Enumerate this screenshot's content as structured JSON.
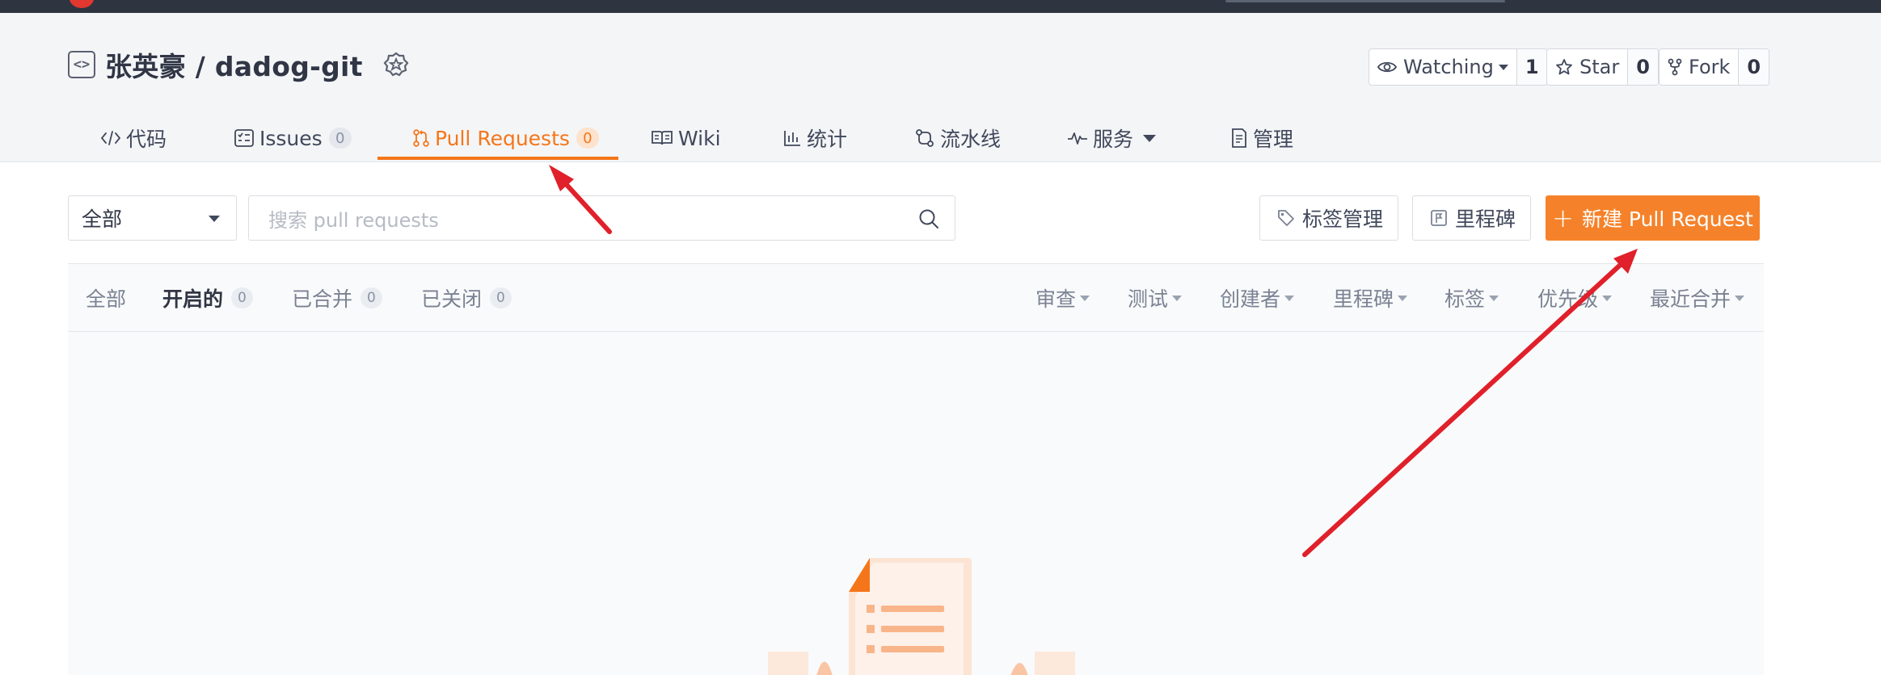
{
  "repo": {
    "owner_and_name": "张英豪 / dadog-git"
  },
  "repo_actions": {
    "watch": {
      "label": "Watching",
      "count": "1"
    },
    "star": {
      "label": "Star",
      "count": "0"
    },
    "fork": {
      "label": "Fork",
      "count": "0"
    }
  },
  "nav": {
    "tabs": [
      {
        "label": "代码",
        "icon": "code-icon"
      },
      {
        "label": "Issues",
        "count": "0",
        "icon": "issues-icon"
      },
      {
        "label": "Pull Requests",
        "count": "0",
        "icon": "pull-request-icon",
        "active": true
      },
      {
        "label": "Wiki",
        "icon": "book-icon"
      },
      {
        "label": "统计",
        "icon": "bar-chart-icon"
      },
      {
        "label": "流水线",
        "icon": "pipeline-icon"
      },
      {
        "label": "服务",
        "icon": "pulse-icon"
      },
      {
        "label": "管理",
        "icon": "document-icon"
      }
    ]
  },
  "toolbar": {
    "scope_select_value": "全部",
    "search_placeholder": "搜索 pull requests",
    "label_manage": "标签管理",
    "milestone": "里程碑",
    "new_pr": "新建 Pull Request"
  },
  "state_tabs": [
    {
      "label": "全部"
    },
    {
      "label": "开启的",
      "count": "0",
      "active": true
    },
    {
      "label": "已合并",
      "count": "0"
    },
    {
      "label": "已关闭",
      "count": "0"
    }
  ],
  "filters": [
    "审查",
    "测试",
    "创建者",
    "里程碑",
    "标签",
    "优先级",
    "最近合并"
  ],
  "colors": {
    "accent": "#f5761a",
    "primary_button": "#f5822a",
    "annotation_arrow": "#e0202a"
  }
}
